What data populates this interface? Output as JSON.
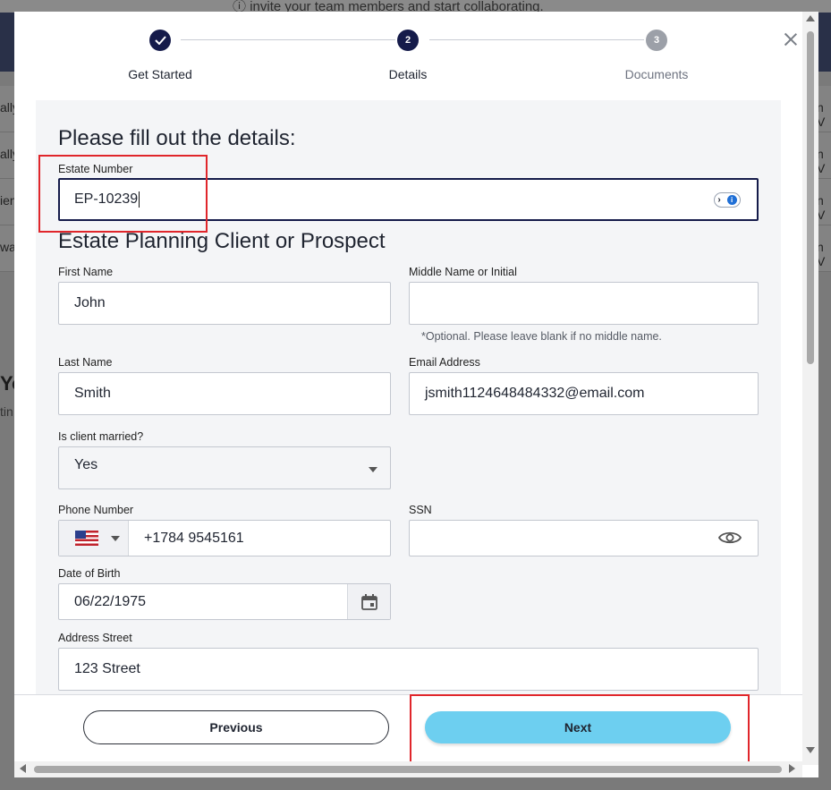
{
  "backdrop": {
    "banner_link": "invite your team members",
    "banner_rest": " and start collaborating.",
    "left_rows": [
      "ally",
      "ally",
      "ien",
      "wa"
    ],
    "right_rows": [
      "n V",
      "n V",
      "n V",
      "n V"
    ],
    "left_heading": "Yo",
    "left_sub": "tin"
  },
  "stepper": {
    "steps": [
      {
        "label": "Get Started",
        "number": "",
        "state": "done"
      },
      {
        "label": "Details",
        "number": "2",
        "state": "active"
      },
      {
        "label": "Documents",
        "number": "3",
        "state": "pending"
      }
    ]
  },
  "form": {
    "heading": "Please fill out the details:",
    "estate_number": {
      "label": "Estate Number",
      "value": "EP-10239"
    },
    "section_heading": "Estate Planning Client or Prospect",
    "first_name": {
      "label": "First Name",
      "value": "John"
    },
    "middle_name": {
      "label": "Middle Name or Initial",
      "value": "",
      "hint": "*Optional. Please leave blank if no middle name."
    },
    "last_name": {
      "label": "Last Name",
      "value": "Smith"
    },
    "email": {
      "label": "Email Address",
      "value": "jsmith1124648484332@email.com"
    },
    "married": {
      "label": "Is client married?",
      "value": "Yes"
    },
    "phone": {
      "label": "Phone Number",
      "value": "+1784 9545161",
      "country": "US"
    },
    "ssn": {
      "label": "SSN",
      "value": ""
    },
    "dob": {
      "label": "Date of Birth",
      "value": "06/22/1975"
    },
    "address": {
      "label": "Address Street",
      "value": "123 Street"
    }
  },
  "footer": {
    "previous_label": "Previous",
    "next_label": "Next"
  },
  "colors": {
    "primary": "#151b4a",
    "next_button": "#6dcff0",
    "highlight": "#e0262b"
  }
}
